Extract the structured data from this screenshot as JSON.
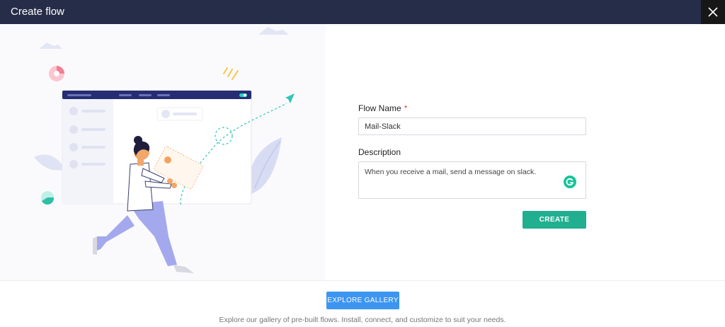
{
  "header": {
    "title": "Create flow",
    "close_icon": "close-icon"
  },
  "form": {
    "flow_name_label": "Flow Name",
    "required_mark": "*",
    "flow_name_value": "Mail-Slack",
    "description_label": "Description",
    "description_value": "When you receive a mail, send a message on slack.",
    "create_label": "CREATE"
  },
  "footer": {
    "explore_label": "EXPLORE GALLERY",
    "explore_text": "Explore our gallery of pre-built flows. Install, connect, and customize to suit your needs."
  },
  "colors": {
    "header_bg": "#262d48",
    "create_button": "#21af8f",
    "explore_button": "#3c95f0"
  }
}
